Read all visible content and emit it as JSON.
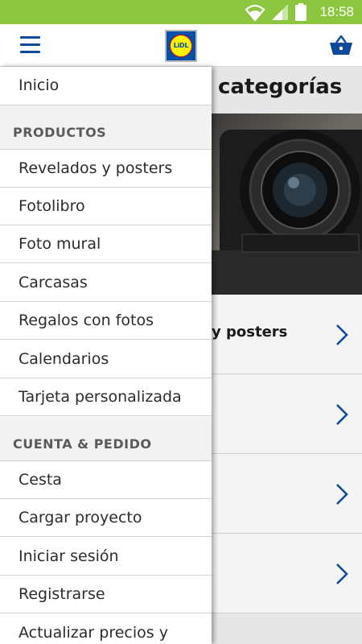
{
  "status_bar": {
    "time": "18:58"
  },
  "app_bar": {
    "logo_text": "LiDL"
  },
  "background": {
    "title": "categorías",
    "rows": [
      {
        "label": "y posters"
      },
      {
        "label": ""
      },
      {
        "label": ""
      },
      {
        "label": ""
      }
    ]
  },
  "drawer": {
    "home": "Inicio",
    "sections": [
      {
        "title": "PRODUCTOS",
        "items": [
          "Revelados y posters",
          "Fotolibro",
          "Foto mural",
          "Carcasas",
          "Regalos con fotos",
          "Calendarios",
          "Tarjeta personalizada"
        ]
      },
      {
        "title": "CUENTA & PEDIDO",
        "items": [
          "Cesta",
          "Cargar proyecto",
          "Iniciar sesión",
          "Registrarse",
          "Actualizar precios y"
        ]
      }
    ]
  },
  "colors": {
    "status_bar": "#8cc63f",
    "brand_blue": "#0050aa",
    "brand_yellow": "#fff200"
  }
}
